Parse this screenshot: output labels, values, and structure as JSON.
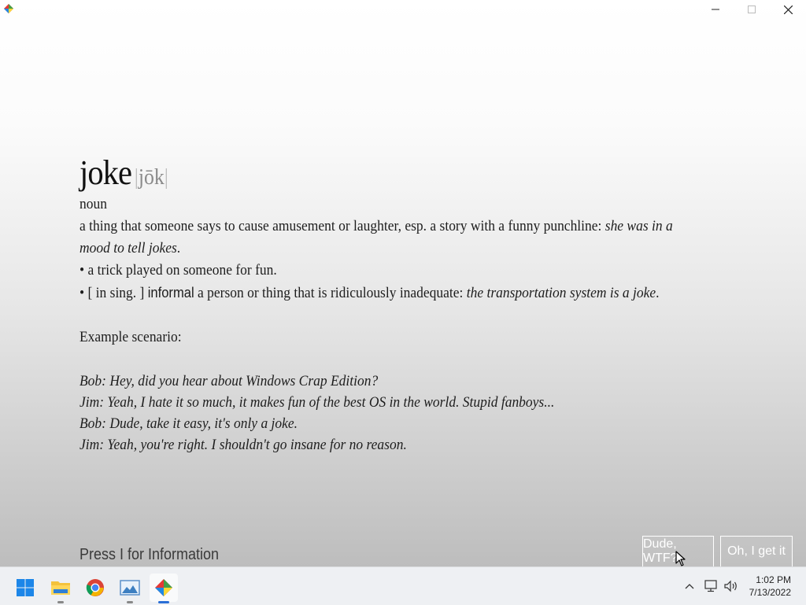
{
  "window": {
    "app_icon": "colorful-diamond-icon",
    "controls": {
      "minimize": "minimize-icon",
      "maximize": "maximize-icon",
      "close": "close-icon"
    }
  },
  "entry": {
    "headword": "joke",
    "pronunciation": "jōk",
    "pos": "noun",
    "def1_text": "a thing that someone says to cause amusement or laughter, esp. a story with a funny punchline: ",
    "def1_example": "she was in a mood to tell jokes",
    "def1_end": ".",
    "def2": "• a trick played on someone for fun.",
    "def3_prefix": "• [ in sing. ] ",
    "def3_informal": "informal",
    "def3_text": " a person or thing that is ridiculously inadequate: ",
    "def3_example": "the transportation system is a joke",
    "def3_end": "."
  },
  "scenario": {
    "heading": "Example scenario:",
    "lines": [
      "Bob: Hey, did you hear about Windows Crap Edition?",
      "Jim: Yeah, I hate it so much, it makes fun of the best OS in the world. Stupid fanboys...",
      "Bob: Dude, take it easy, it's only a joke.",
      "Jim: Yeah, you're right. I shouldn't go insane for no reason."
    ]
  },
  "footer": {
    "press_info": "Press I for Information",
    "buttons": [
      "Dude, WTF?",
      "Oh, I get it"
    ]
  },
  "taskbar": {
    "apps": [
      "windows-start-icon",
      "file-explorer-icon",
      "chrome-icon",
      "image-viewer-icon",
      "colorful-diamond-app-icon"
    ],
    "tray_icons": [
      "chevron-up-icon",
      "network-icon",
      "volume-icon"
    ],
    "time": "1:02 PM",
    "date": "7/13/2022"
  }
}
